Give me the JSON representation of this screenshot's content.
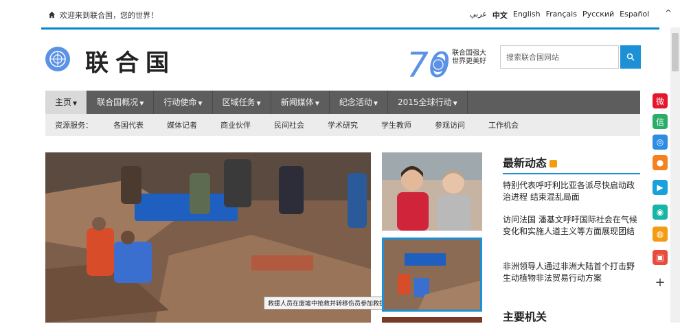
{
  "topbar": {
    "welcome": "欢迎来到联合国，您的世界！",
    "languages": [
      "عربي",
      "中文",
      "English",
      "Français",
      "Русский",
      "Español"
    ]
  },
  "header": {
    "title": "联合国",
    "anniversary_number": "70",
    "slogan": "联合国强大 世界更美好",
    "search_placeholder": "搜索联合国网站"
  },
  "main_nav": [
    {
      "label": "主页",
      "caret": "▼"
    },
    {
      "label": "联合国概况",
      "caret": "▼"
    },
    {
      "label": "行动使命",
      "caret": "▼"
    },
    {
      "label": "区域任务",
      "caret": "▼"
    },
    {
      "label": "新闻媒体",
      "caret": "▼"
    },
    {
      "label": "纪念活动",
      "caret": "▼"
    },
    {
      "label": "2015全球行动",
      "caret": "▼"
    }
  ],
  "sub_nav": {
    "label": "资源服务：",
    "links": [
      "各国代表",
      "媒体记者",
      "商业伙伴",
      "民间社会",
      "学术研究",
      "学生教师",
      "参观访问",
      "工作机会"
    ]
  },
  "hero": {
    "caption": "救援人员在废墟中抢救并转移伤员参加救援工作。"
  },
  "news": {
    "heading": "最新动态",
    "items": [
      "特别代表呼吁利比亚各派尽快启动政治进程 结束混乱局面",
      "访问法国 潘基文呼吁国际社会在气候变化和实施人道主义等方面展现团结",
      "非洲领导人通过非洲大陆首个打击野生动植物非法贸易行动方案"
    ]
  },
  "org_heading": "主要机关",
  "social_icons": [
    {
      "name": "weibo-icon",
      "color": "#e6162d",
      "glyph": "微"
    },
    {
      "name": "wechat-icon",
      "color": "#2aae67",
      "glyph": "信"
    },
    {
      "name": "compass-icon",
      "color": "#2d8de3",
      "glyph": "◎"
    },
    {
      "name": "orange-app-icon",
      "color": "#f5821f",
      "glyph": "●"
    },
    {
      "name": "play-icon",
      "color": "#1aa0db",
      "glyph": "▶"
    },
    {
      "name": "location-icon",
      "color": "#16b5a5",
      "glyph": "◉"
    },
    {
      "name": "circle-app-icon",
      "color": "#f39c12",
      "glyph": "◍"
    },
    {
      "name": "video-icon",
      "color": "#e74c3c",
      "glyph": "▣"
    },
    {
      "name": "more-icon",
      "color": "#ffffff",
      "glyph": "+"
    }
  ],
  "colors": {
    "accent": "#1e90d6",
    "nav_bg": "#5d5d5d",
    "subnav_bg": "#ececec",
    "un_blue": "#5b92e5"
  }
}
